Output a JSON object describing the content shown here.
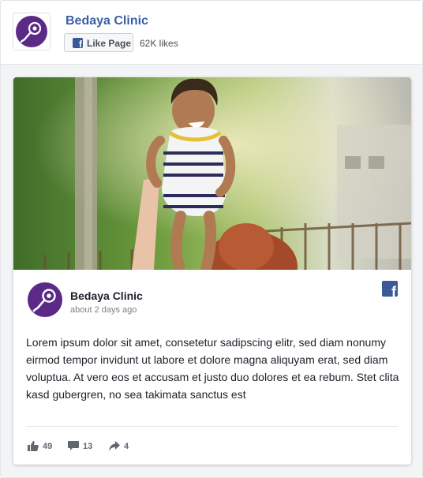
{
  "header": {
    "page_name": "Bedaya Clinic",
    "like_button_label": "Like Page",
    "likes_count": "62K likes",
    "logo_icon": "bedaya-logo-icon",
    "facebook_icon": "facebook-f-icon"
  },
  "post": {
    "photo_alt": "child-photo",
    "author": "Bedaya Clinic",
    "timestamp": "about 2 days ago",
    "text": "Lorem ipsum dolor sit amet, consetetur sadipscing elitr, sed diam nonumy eirmod tempor invidunt ut labore et dolore magna aliquyam erat, sed diam voluptua. At vero eos et accusam et justo duo dolores et ea rebum. Stet clita kasd gubergren, no sea takimata sanctus est",
    "stats": {
      "likes": "49",
      "comments": "13",
      "shares": "4"
    }
  },
  "colors": {
    "brand_purple": "#5b2a86",
    "facebook_blue": "#3b5998",
    "page_name_blue": "#3b5ea8"
  }
}
